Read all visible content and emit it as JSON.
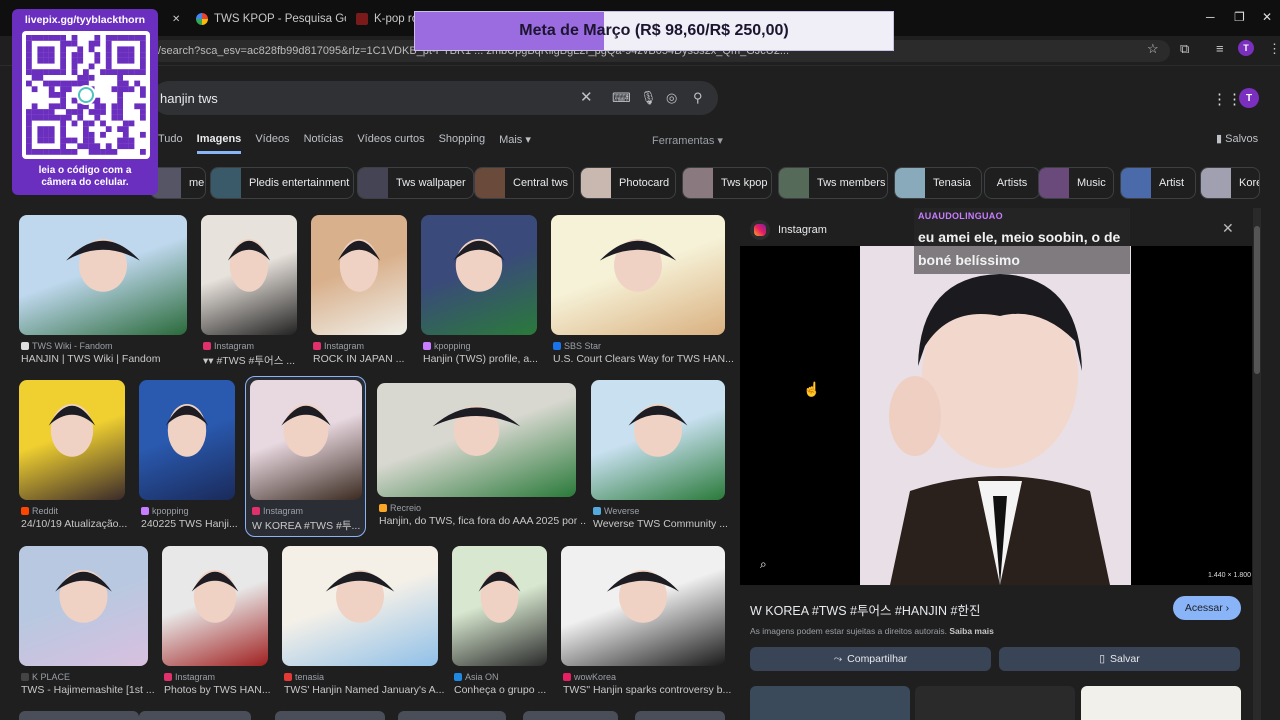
{
  "tabs": [
    {
      "label": "TWS KPOP - Pesquisa Google",
      "color": "#4285f4"
    },
    {
      "label": "K-pop rookie",
      "color": "#e53935"
    }
  ],
  "url": "/search?sca_esv=ac828fb99d817095&rlz=1C1VDKB_pt-PTBR1 ... zmbUpgBqRiigBgL2I_pgQa-94zvB054Dys3s2x_Qm_GJcU2...",
  "profile_initial": "T",
  "search": {
    "query": "hanjin tws"
  },
  "nav": {
    "tabs": [
      "Tudo",
      "Imagens",
      "Vídeos",
      "Notícias",
      "Vídeos curtos",
      "Shopping",
      "Mais ▾"
    ],
    "tools": "Ferramentas ▾",
    "saved": "Salvos"
  },
  "chips": [
    {
      "label": "member",
      "color": "#556"
    },
    {
      "label": "Pledis entertainment",
      "color": "#3a5a6a"
    },
    {
      "label": "Tws wallpaper",
      "color": "#445"
    },
    {
      "label": "Central tws",
      "color": "#6a4a3a"
    },
    {
      "label": "Photocard",
      "color": "#c9b8b0"
    },
    {
      "label": "Tws kpop",
      "color": "#8a7a80"
    },
    {
      "label": "Tws members",
      "color": "#566a5a"
    },
    {
      "label": "Tenasia",
      "color": "#8ab"
    },
    {
      "label": "Artists",
      "color": ""
    },
    {
      "label": "Music",
      "color": "#6a4a7a"
    },
    {
      "label": "Artist",
      "color": "#4a6aaa"
    },
    {
      "label": "Kore",
      "color": "#a0a0b0"
    }
  ],
  "results": [
    {
      "source": "TWS Wiki - Fandom",
      "title": "HANJIN | TWS Wiki | Fandom",
      "fav": "#ddd",
      "c1": "#bfd8ee",
      "c2": "#2a6a3a"
    },
    {
      "source": "Instagram",
      "title": "▾▾ #TWS #투어스 ...",
      "fav": "#e1306c",
      "c1": "#e8e2dc",
      "c2": "#222"
    },
    {
      "source": "Instagram",
      "title": "ROCK IN JAPAN ...",
      "fav": "#e1306c",
      "c1": "#d9b08c",
      "c2": "#f0efe8"
    },
    {
      "source": "kpopping",
      "title": "Hanjin (TWS) profile, a...",
      "fav": "#c77dff",
      "c1": "#3a4a7a",
      "c2": "#2a7a3a"
    },
    {
      "source": "SBS Star",
      "title": "U.S. Court Clears Way for TWS HAN...",
      "fav": "#1a73e8",
      "c1": "#f6f2d8",
      "c2": "#d9b080"
    },
    {
      "source": "Reddit",
      "title": "24/10/19 Atualização...",
      "fav": "#ff4500",
      "c1": "#f0d030",
      "c2": "#3a2a2a"
    },
    {
      "source": "kpopping",
      "title": "240225 TWS Hanji...",
      "fav": "#c77dff",
      "c1": "#2a5ab0",
      "c2": "#1a2a5a"
    },
    {
      "source": "Instagram",
      "title": "W KOREA #TWS #투...",
      "fav": "#e1306c",
      "c1": "#e8d8e0",
      "c2": "#3a2a20"
    },
    {
      "source": "Recreio",
      "title": "Hanjin, do TWS, fica fora do AAA 2025 por ...",
      "fav": "#f9a825",
      "c1": "#d8d8d0",
      "c2": "#2a7a3a"
    },
    {
      "source": "Weverse",
      "title": "Weverse TWS Community ...",
      "fav": "#5ad",
      "c1": "#c8e0f0",
      "c2": "#2a7a3a"
    },
    {
      "source": "K PLACE",
      "title": "TWS - Hajimemashite [1st ...",
      "fav": "#444",
      "c1": "#b8c8e0",
      "c2": "#d8c0e0"
    },
    {
      "source": "Instagram",
      "title": "Photos by TWS HAN...",
      "fav": "#e1306c",
      "c1": "#e8e8e8",
      "c2": "#a02020"
    },
    {
      "source": "tenasia",
      "title": "TWS' Hanjin Named January's A...",
      "fav": "#e53935",
      "c1": "#f4f0e8",
      "c2": "#90c0e8"
    },
    {
      "source": "Asia ON",
      "title": "Conheça o grupo ...",
      "fav": "#1e88e5",
      "c1": "#d8e8d0",
      "c2": "#2a2a2a"
    },
    {
      "source": "wowKorea",
      "title": "TWS\" Hanjin sparks controversy b...",
      "fav": "#e91e63",
      "c1": "#f0f0f0",
      "c2": "#1a1a1a"
    }
  ],
  "panel": {
    "source": "Instagram",
    "title": "W KOREA #TWS #투어스 #HANJIN #한진",
    "copyright": "As imagens podem estar sujeitas a direitos autorais.",
    "learn_more": "Saiba mais",
    "visit": "Acessar ›",
    "share": "Compartilhar",
    "save": "Salvar",
    "dims": "1.440 × 1.800"
  },
  "overlay": {
    "qr_top": "livepix.gg/tyyblackthorn",
    "qr_bottom": "leia o código com a câmera do celular.",
    "goal": "Meta de Março (R$ 98,60/R$ 250,00)",
    "goal_progress": 0.3944,
    "chat_user": "AUAUDOLINGUAO",
    "chat_msg": "eu amei ele, meio soobin, o de boné belíssimo"
  }
}
